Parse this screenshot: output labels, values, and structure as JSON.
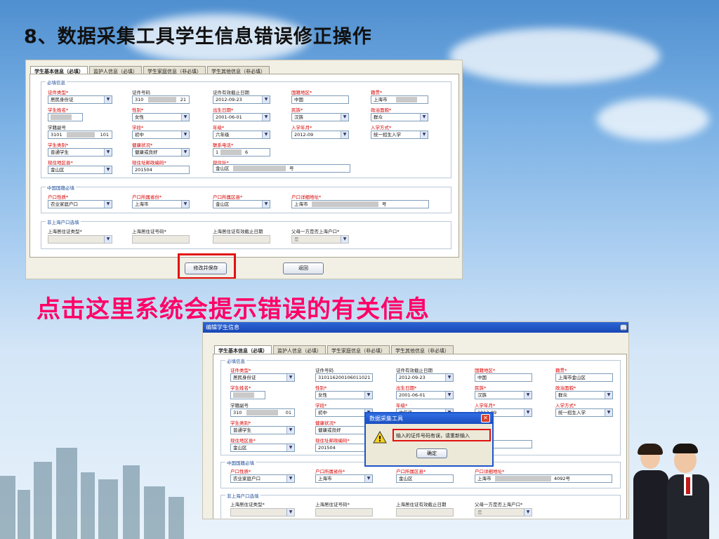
{
  "slide": {
    "title": "8、数据采集工具学生信息错误修正操作",
    "caption": "点击这里系统会提示错误的有关信息"
  },
  "tabs": [
    "学生基本信息（必填）",
    "监护人信息（必填）",
    "学生家庭信息（非必填）",
    "学生其他信息（非必填）"
  ],
  "sections": {
    "required": "必填信息",
    "region": "中国国籍必填",
    "non_shanghai": "非上海户口选填"
  },
  "labels": {
    "id_type": "证件类型*",
    "id_number": "证件号码",
    "id_valid_date": "证件有效截止日期",
    "country": "国籍地区*",
    "native_place": "籍贯*",
    "name": "学生姓名*",
    "gender": "性别*",
    "birthday": "出生日期*",
    "ethnicity": "民族*",
    "political": "政治面貌*",
    "student_no": "学籍副号",
    "school_stage": "学段*",
    "grade": "年级*",
    "enroll_date": "入学年月*",
    "enroll_method": "入学方式*",
    "student_type": "学生类别*",
    "health": "健康状况*",
    "phone": "联系电话*",
    "district": "现住地区县*",
    "postcode": "现住址邮政编码*",
    "address": "现住址*",
    "hukou_type": "户口性质*",
    "hukou_province": "户口所属省份*",
    "hukou_district": "户口所属区县*",
    "hukou_address": "户口详细地址*",
    "residence_type": "上海居住证类型*",
    "residence_no": "上海居住证号码*",
    "residence_valid": "上海居住证有效截止日期",
    "parent_hukou": "父母一方是否上海户口*"
  },
  "panel1": {
    "id_type": "居民身份证",
    "id_number_start": "310",
    "id_number_end": "21",
    "id_valid_date": "2012-09-23",
    "country": "中国",
    "native_place": "上海市",
    "gender": "女性",
    "birthday": "2001-06-01",
    "ethnicity": "汉族",
    "political": "群众",
    "student_no_start": "3101",
    "student_no_end": "101",
    "school_stage": "初中",
    "grade": "六年级",
    "enroll_date": "2012-09",
    "enroll_method": "统一招生入学",
    "student_type": "普通学生",
    "health": "健康或良好",
    "phone_start": "1",
    "phone_end": "6",
    "district": "金山区",
    "postcode": "201504",
    "address_start": "金山区",
    "address_end": "号",
    "hukou_type": "农业家庭户口",
    "hukou_province": "上海市",
    "hukou_district": "金山区",
    "hukou_address_start": "上海市",
    "hukou_address_end": "号",
    "parent_hukou": "是",
    "save_button": "修改并保存",
    "back_button": "返回"
  },
  "panel2": {
    "window_title": "编辑学生信息",
    "id_type": "居民身份证",
    "id_number": "310116200106011021",
    "id_valid_date": "2012-09-23",
    "country": "中国",
    "native_place": "上海市金山区",
    "gender": "女性",
    "birthday": "2001-06-01",
    "ethnicity": "汉族",
    "political": "群众",
    "student_no_start": "310",
    "student_no_end": "01",
    "school_stage": "初中",
    "grade": "六年级",
    "enroll_date": "2012-09",
    "enroll_method": "统一招生入学",
    "student_type": "普通学生",
    "health": "健康或良好",
    "district": "金山区",
    "postcode": "201504",
    "hukou_type": "农业家庭户口",
    "hukou_province": "上海市",
    "hukou_district": "金山区",
    "hukou_address_start": "上海市",
    "hukou_address_end": "4092号",
    "parent_hukou": "是"
  },
  "dialog": {
    "title": "数据采集工具",
    "message": "输入的证件号码有误，请重新输入",
    "ok": "确定"
  },
  "colors": {
    "required_label": "#d80000",
    "caption": "#ff0066",
    "highlight": "#e01010",
    "window_title": "#1846b5"
  }
}
